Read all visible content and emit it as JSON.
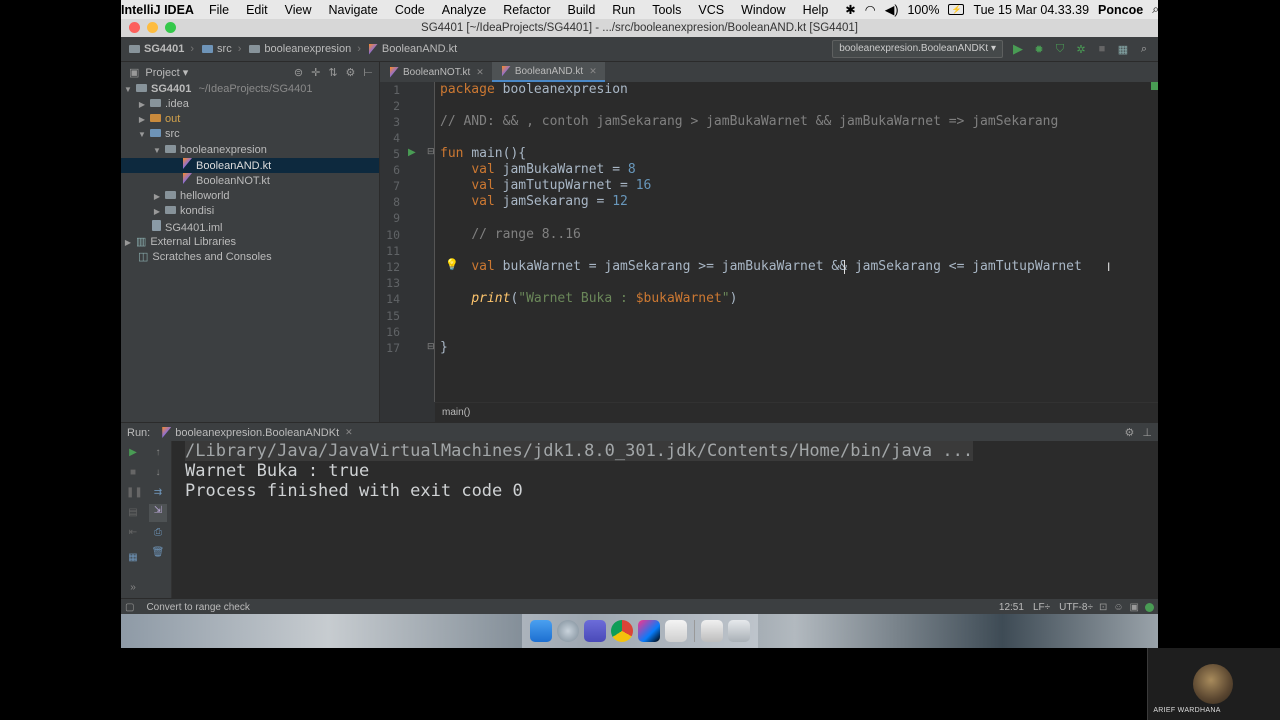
{
  "menubar": {
    "app_name": "IntelliJ IDEA",
    "menus": [
      "File",
      "Edit",
      "View",
      "Navigate",
      "Code",
      "Analyze",
      "Refactor",
      "Build",
      "Run",
      "Tools",
      "VCS",
      "Window",
      "Help"
    ],
    "battery_percent": "100%",
    "battery_label": "⚡",
    "datetime": "Tue 15 Mar  04.33.39",
    "user": "Poncoe"
  },
  "window": {
    "title": "SG4401 [~/IdeaProjects/SG4401] - .../src/booleanexpresion/BooleanAND.kt [SG4401]"
  },
  "navbar": {
    "crumbs": [
      "SG4401",
      "src",
      "booleanexpresion",
      "BooleanAND.kt"
    ],
    "run_config": "booleanexpresion.BooleanANDKt"
  },
  "project_pane": {
    "title": "Project",
    "tree": [
      {
        "label": "SG4401",
        "extra": "~/IdeaProjects/SG4401",
        "depth": 0,
        "expanded": true,
        "type": "module"
      },
      {
        "label": ".idea",
        "depth": 1,
        "expanded": false,
        "type": "folder"
      },
      {
        "label": "out",
        "depth": 1,
        "expanded": false,
        "type": "folder-excluded"
      },
      {
        "label": "src",
        "depth": 1,
        "expanded": true,
        "type": "folder-source"
      },
      {
        "label": "booleanexpresion",
        "depth": 2,
        "expanded": true,
        "type": "package"
      },
      {
        "label": "BooleanAND.kt",
        "depth": 3,
        "type": "kotlin-file",
        "selected": true
      },
      {
        "label": "BooleanNOT.kt",
        "depth": 3,
        "type": "kotlin-file"
      },
      {
        "label": "helloworld",
        "depth": 2,
        "expanded": false,
        "type": "package"
      },
      {
        "label": "kondisi",
        "depth": 2,
        "expanded": false,
        "type": "package"
      },
      {
        "label": "SG4401.iml",
        "depth": 1,
        "type": "iml-file"
      },
      {
        "label": "External Libraries",
        "depth": 0,
        "expanded": false,
        "type": "libraries"
      },
      {
        "label": "Scratches and Consoles",
        "depth": 0,
        "type": "scratches"
      }
    ]
  },
  "editor": {
    "tabs": [
      {
        "label": "BooleanNOT.kt",
        "active": false
      },
      {
        "label": "BooleanAND.kt",
        "active": true
      }
    ],
    "line_numbers": [
      "1",
      "2",
      "3",
      "4",
      "5",
      "6",
      "7",
      "8",
      "9",
      "10",
      "11",
      "12",
      "13",
      "14",
      "15",
      "16",
      "17"
    ],
    "code": {
      "l1_kw": "package",
      "l1_rest": " booleanexpresion",
      "l3": "// AND: && , contoh jamSekarang > jamBukaWarnet && jamBukaWarnet => jamSekarang",
      "l5_kw": "fun",
      "l5_fn": "main",
      "l5_rest": "(){",
      "val_kw": "val",
      "l6_name": "jamBukaWarnet",
      "l6_eq": " = ",
      "l6_num": "8",
      "l7_name": "jamTutupWarnet",
      "l7_num": "16",
      "l8_name": "jamSekarang",
      "l8_num": "12",
      "l10": "// range 8..16",
      "l12_rest": "bukaWarnet = jamSekarang >= jamBukaWarnet && jamSekarang <= jamTutupWarnet",
      "l14_fn": "print",
      "l14_open": "(",
      "l14_str": "\"Warnet Buka : ",
      "l14_tmpl": "$bukaWarnet",
      "l14_close": "\"",
      "l14_end": ")",
      "l17": "}"
    },
    "breadcrumb": "main()"
  },
  "run_panel": {
    "label": "Run:",
    "tab": "booleanexpresion.BooleanANDKt",
    "console": [
      "/Library/Java/JavaVirtualMachines/jdk1.8.0_301.jdk/Contents/Home/bin/java ...",
      "Warnet Buka : true",
      "Process finished with exit code 0"
    ]
  },
  "statusbar": {
    "message": "Convert to range check",
    "position": "12:51",
    "line_sep": "LF÷",
    "encoding": "UTF-8÷"
  },
  "overlay": {
    "presenter": "ARIEF WARDHANA"
  }
}
